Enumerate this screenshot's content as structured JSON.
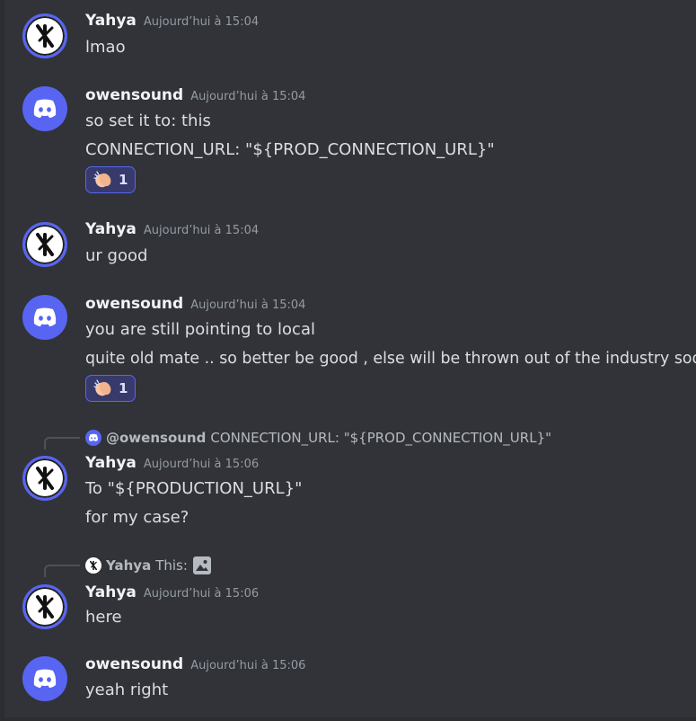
{
  "colors": {
    "background": "#313338",
    "blurple": "#5865f2",
    "username": "#f2f3f5",
    "timestamp": "#949ba4",
    "text": "#dbdee1"
  },
  "messages": [
    {
      "author": "Yahya",
      "timestamp": "Aujourd’hui à 15:04",
      "lines": [
        "lmao"
      ]
    },
    {
      "author": "owensound",
      "timestamp": "Aujourd’hui à 15:04",
      "lines": [
        "so set it to: this",
        "CONNECTION_URL: \"${PROD_CONNECTION_URL}\""
      ],
      "reaction": {
        "emoji": "clapping-hands",
        "count": "1"
      }
    },
    {
      "author": "Yahya",
      "timestamp": "Aujourd’hui à 15:04",
      "lines": [
        "ur good"
      ]
    },
    {
      "author": "owensound",
      "timestamp": "Aujourd’hui à 15:04",
      "lines": [
        "you are still pointing to local",
        "quite old mate .. so better be good , else will be thrown out of the industry soon"
      ],
      "reaction": {
        "emoji": "clapping-hands",
        "count": "1"
      }
    },
    {
      "reply": {
        "author": "@owensound",
        "text": "CONNECTION_URL: \"${PROD_CONNECTION_URL}\""
      },
      "author": "Yahya",
      "timestamp": "Aujourd’hui à 15:06",
      "lines": [
        "To \"${PRODUCTION_URL}\"",
        "for my case?"
      ]
    },
    {
      "reply": {
        "author": "Yahya",
        "text": "This:",
        "attachment_icon": "image-icon"
      },
      "author": "Yahya",
      "timestamp": "Aujourd’hui à 15:06",
      "lines": [
        "here"
      ]
    },
    {
      "author": "owensound",
      "timestamp": "Aujourd’hui à 15:06",
      "lines": [
        "yeah right"
      ]
    }
  ]
}
